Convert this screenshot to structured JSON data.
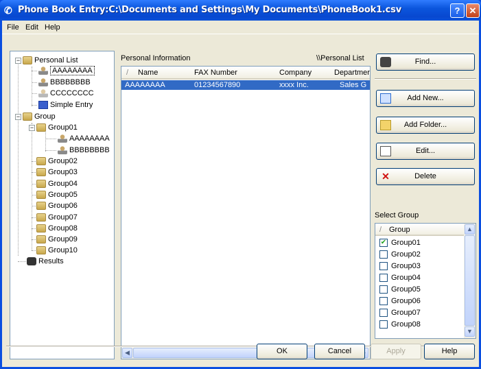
{
  "window": {
    "title": "Phone Book Entry:C:\\Documents and Settings\\My Documents\\PhoneBook1.csv",
    "help_btn": "?",
    "close_btn": "✕"
  },
  "menu": [
    "File",
    "Edit",
    "Help"
  ],
  "tree": {
    "personal_list": "Personal List",
    "personal_items": [
      "AAAAAAAA",
      "BBBBBBBB",
      "CCCCCCCC"
    ],
    "simple_entry": "Simple Entry",
    "group": "Group",
    "group01": "Group01",
    "group01_items": [
      "AAAAAAAA",
      "BBBBBBBB"
    ],
    "groups": [
      "Group02",
      "Group03",
      "Group04",
      "Group05",
      "Group06",
      "Group07",
      "Group08",
      "Group09",
      "Group10"
    ],
    "results": "Results"
  },
  "list": {
    "label": "Personal Information",
    "path": "\\\\Personal List",
    "columns": [
      "Name",
      "FAX Number",
      "Company",
      "Departmer"
    ],
    "rows": [
      [
        "AAAAAAAA",
        "01234567890",
        "xxxx Inc.",
        "Sales G"
      ]
    ]
  },
  "buttons": {
    "find": "Find...",
    "add_new": "Add New...",
    "add_folder": "Add Folder...",
    "edit": "Edit...",
    "delete": "Delete"
  },
  "select_group": {
    "label": "Select Group",
    "header": "Group",
    "items": [
      {
        "name": "Group01",
        "checked": true
      },
      {
        "name": "Group02",
        "checked": false
      },
      {
        "name": "Group03",
        "checked": false
      },
      {
        "name": "Group04",
        "checked": false
      },
      {
        "name": "Group05",
        "checked": false
      },
      {
        "name": "Group06",
        "checked": false
      },
      {
        "name": "Group07",
        "checked": false
      },
      {
        "name": "Group08",
        "checked": false
      }
    ]
  },
  "footer": {
    "ok": "OK",
    "cancel": "Cancel",
    "apply": "Apply",
    "help": "Help"
  },
  "colors": {
    "titlebar": "#0a4ee0",
    "selection": "#316ac5",
    "face": "#ece9d8"
  }
}
